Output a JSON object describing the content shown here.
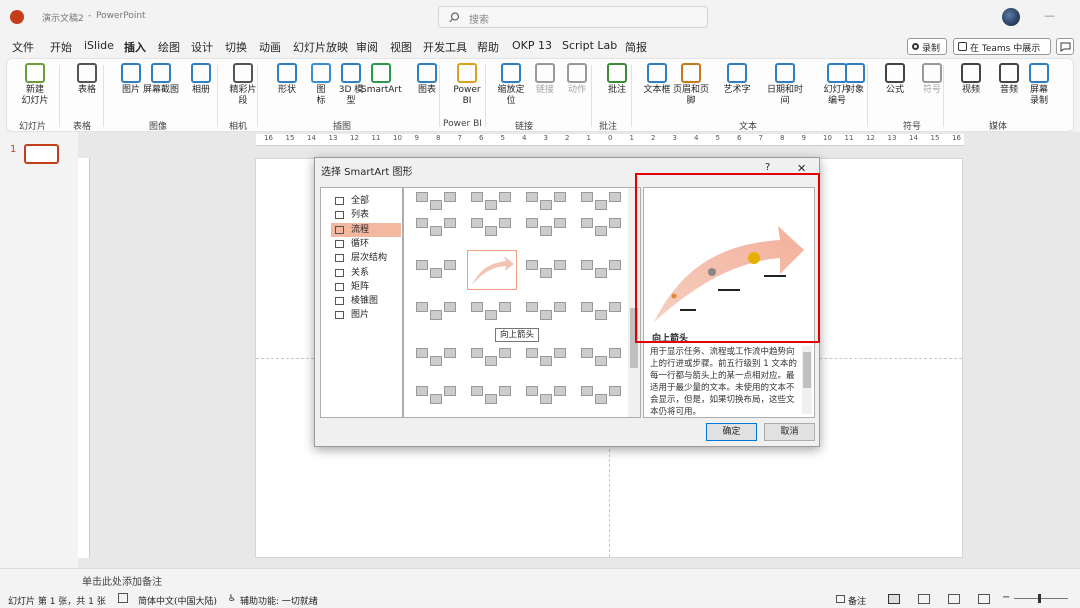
{
  "window": {
    "title": "演示文稿2",
    "app": "PowerPoint",
    "search_placeholder": "搜索"
  },
  "tabs": [
    "文件",
    "开始",
    "iSlide",
    "插入",
    "绘图",
    "设计",
    "切换",
    "动画",
    "幻灯片放映",
    "审阅",
    "视图",
    "开发工具",
    "帮助",
    "OKP 13",
    "Script Lab",
    "简报"
  ],
  "tab_active": "插入",
  "header_actions": {
    "record": "录制",
    "teams": "在 Teams 中展示"
  },
  "ribbon": {
    "buttons": [
      {
        "label": "新建\n幻灯片",
        "icon": "new-slide-icon"
      },
      {
        "label": "表格",
        "icon": "table-icon"
      },
      {
        "label": "图片",
        "icon": "picture-icon"
      },
      {
        "label": "屏幕截图",
        "icon": "screenshot-icon"
      },
      {
        "label": "相册",
        "icon": "album-icon"
      },
      {
        "label": "精彩片\n段",
        "icon": "highlight-icon"
      },
      {
        "label": "形状",
        "icon": "shapes-icon"
      },
      {
        "label": "图\n标",
        "icon": "icons-icon"
      },
      {
        "label": "3D 模\n型",
        "icon": "3d-model-icon"
      },
      {
        "label": "SmartArt",
        "icon": "smartart-icon"
      },
      {
        "label": "图表",
        "icon": "chart-icon"
      },
      {
        "label": "Power\nBI",
        "icon": "powerbi-icon"
      },
      {
        "label": "缩放定\n位",
        "icon": "zoom-icon"
      },
      {
        "label": "链接",
        "icon": "link-icon"
      },
      {
        "label": "动作",
        "icon": "action-icon"
      },
      {
        "label": "批注",
        "icon": "comment-icon"
      },
      {
        "label": "文本框",
        "icon": "textbox-icon"
      },
      {
        "label": "页眉和页脚",
        "icon": "header-footer-icon"
      },
      {
        "label": "艺术字",
        "icon": "wordart-icon"
      },
      {
        "label": "日期和时间",
        "icon": "datetime-icon"
      },
      {
        "label": "幻灯片\n编号",
        "icon": "slide-number-icon"
      },
      {
        "label": "对象",
        "icon": "object-icon"
      },
      {
        "label": "公式",
        "icon": "equation-icon"
      },
      {
        "label": "符号",
        "icon": "symbol-icon"
      },
      {
        "label": "视频",
        "icon": "video-icon"
      },
      {
        "label": "音频",
        "icon": "audio-icon"
      },
      {
        "label": "屏幕\n录制",
        "icon": "screen-record-icon"
      }
    ],
    "groups": [
      "幻灯片",
      "表格",
      "图像",
      "相机",
      "插图",
      "Power BI",
      "链接",
      "批注",
      "文本",
      "符号",
      "媒体"
    ]
  },
  "ruler": [
    "16",
    "15",
    "14",
    "13",
    "12",
    "11",
    "10",
    "9",
    "8",
    "7",
    "6",
    "5",
    "4",
    "3",
    "2",
    "1",
    "0",
    "1",
    "2",
    "3",
    "4",
    "5",
    "6",
    "7",
    "8",
    "9",
    "10",
    "11",
    "12",
    "13",
    "14",
    "15",
    "16"
  ],
  "thumbnail": {
    "number": "1"
  },
  "dialog": {
    "title": "选择 SmartArt 图形",
    "help": "?",
    "close": "✕",
    "categories": [
      "全部",
      "列表",
      "流程",
      "循环",
      "层次结构",
      "关系",
      "矩阵",
      "棱锥图",
      "图片"
    ],
    "selected_category": "流程",
    "tooltip": "向上箭头",
    "preview_name": "向上箭头",
    "description": "用于显示任务、流程或工作流中趋势向上的行进或步骤。前五行级别 1 文本的每一行都与箭头上的某一点相对应。最适用于最少量的文本。未使用的文本不会显示，但是，如果切换布局，这些文本仍将可用。",
    "ok": "确定",
    "cancel": "取消"
  },
  "notes_placeholder": "单击此处添加备注",
  "status": {
    "slide": "幻灯片 第 1 张，共 1 张",
    "language": "简体中文(中国大陆)",
    "accessibility": "辅助功能: 一切就绪",
    "notes": "备注"
  },
  "colors": {
    "accent": "#c43e1c",
    "highlight_red": "#e00000",
    "selection": "#f4b8a0"
  }
}
